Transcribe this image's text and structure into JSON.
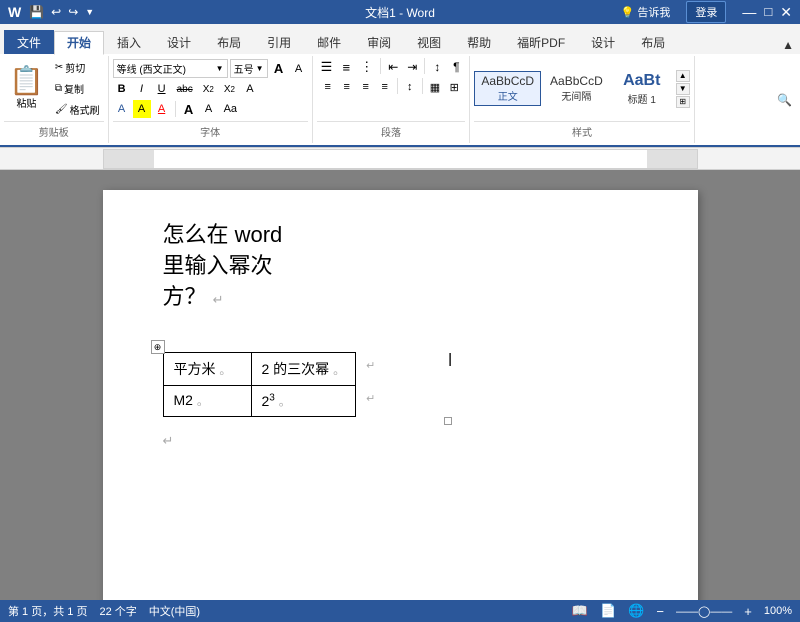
{
  "titlebar": {
    "title": "文档1 - Word",
    "login_label": "登录",
    "window_controls": [
      "—",
      "□",
      "×"
    ]
  },
  "tabs": [
    {
      "label": "文件",
      "active": false
    },
    {
      "label": "开始",
      "active": true
    },
    {
      "label": "插入",
      "active": false
    },
    {
      "label": "设计",
      "active": false
    },
    {
      "label": "布局",
      "active": false
    },
    {
      "label": "引用",
      "active": false
    },
    {
      "label": "邮件",
      "active": false
    },
    {
      "label": "审阅",
      "active": false
    },
    {
      "label": "视图",
      "active": false
    },
    {
      "label": "帮助",
      "active": false
    },
    {
      "label": "福昕PDF",
      "active": false
    },
    {
      "label": "设计",
      "active": false
    },
    {
      "label": "布局",
      "active": false
    }
  ],
  "ribbon": {
    "clipboard_group": {
      "label": "剪贴板",
      "paste_label": "粘贴",
      "cut_label": "剪切",
      "copy_label": "复制",
      "format_painter_label": "格式刷"
    },
    "font_group": {
      "label": "字体",
      "font_name": "等线 (西文正文)",
      "font_size": "五号",
      "bold": "B",
      "italic": "I",
      "underline": "U",
      "strikethrough": "abc",
      "superscript": "X²",
      "subscript": "X₂",
      "clear_format": "A",
      "text_color": "A",
      "highlight": "A",
      "font_color_label": "A"
    },
    "paragraph_group": {
      "label": "段落"
    },
    "styles_group": {
      "label": "样式",
      "styles": [
        {
          "name": "正文",
          "preview": "AaBbCcD",
          "active": true
        },
        {
          "name": "无间隔",
          "preview": "AaBbCcD",
          "active": false
        },
        {
          "name": "标题 1",
          "preview": "AaBt",
          "active": false
        }
      ]
    }
  },
  "document": {
    "heading": "怎么在 word\n里输入幂次\n方？",
    "table": {
      "rows": [
        [
          "平方米",
          "2 的三次幂"
        ],
        [
          "M2",
          "23"
        ]
      ],
      "cell_1_1_superscript": "",
      "cell_2_2_superscript": "3"
    }
  },
  "statusbar": {
    "page_info": "第 1 页，共 1 页",
    "word_count": "22 个字",
    "language": "中文(中国)"
  }
}
